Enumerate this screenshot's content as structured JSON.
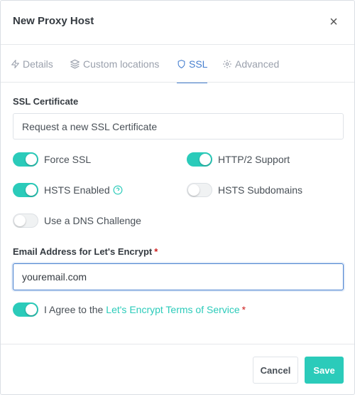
{
  "modal": {
    "title": "New Proxy Host",
    "close_symbol": "×"
  },
  "tabs": [
    {
      "label": "Details",
      "icon": "zap-icon",
      "active": false
    },
    {
      "label": "Custom locations",
      "icon": "layers-icon",
      "active": false
    },
    {
      "label": "SSL",
      "icon": "shield-icon",
      "active": true
    },
    {
      "label": "Advanced",
      "icon": "gear-icon",
      "active": false
    }
  ],
  "ssl": {
    "certificate_label": "SSL Certificate",
    "certificate_value": "Request a new SSL Certificate",
    "toggles": {
      "force_ssl": {
        "label": "Force SSL",
        "on": true
      },
      "http2": {
        "label": "HTTP/2 Support",
        "on": true
      },
      "hsts_enabled": {
        "label": "HSTS Enabled",
        "on": true
      },
      "hsts_subdomains": {
        "label": "HSTS Subdomains",
        "on": false
      },
      "dns_challenge": {
        "label": "Use a DNS Challenge",
        "on": false
      }
    },
    "email_label": "Email Address for Let's Encrypt",
    "required_mark": "*",
    "email_value": "youremail.com",
    "agree_prefix": "I Agree to the",
    "agree_link": "Let's Encrypt Terms of Service",
    "agree_on": true
  },
  "footer": {
    "cancel_label": "Cancel",
    "save_label": "Save"
  },
  "colors": {
    "accent_teal": "#2bcbba",
    "active_tab_blue": "#467fcf",
    "required_red": "#cd201f"
  }
}
